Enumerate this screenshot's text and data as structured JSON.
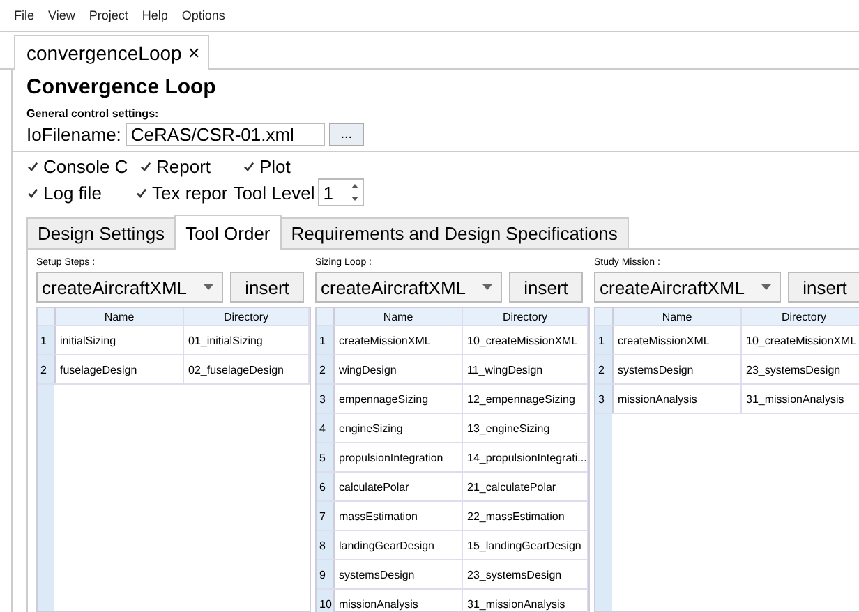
{
  "menu": [
    "File",
    "View",
    "Project",
    "Help",
    "Options"
  ],
  "document_tab": {
    "label": "convergenceLoop",
    "close": "✕",
    "selected": true
  },
  "title": "Convergence Loop",
  "section_label": "General control settings:",
  "io_file": {
    "label": "IoFilename:",
    "value": "CeRAS/CSR-01.xml",
    "button": "..."
  },
  "checkboxes": [
    {
      "label": "Console C",
      "checked": true
    },
    {
      "label": "Report",
      "checked": true
    },
    {
      "label": "Plot",
      "checked": true
    },
    {
      "label": "Log file",
      "checked": true
    },
    {
      "label": "Tex repor",
      "checked": true
    }
  ],
  "tool_level": {
    "label": "Tool Level",
    "value": "1"
  },
  "tabs": [
    {
      "label": "Design Settings",
      "selected": false
    },
    {
      "label": "Tool Order",
      "selected": true
    },
    {
      "label": "Requirements and Design Specifications",
      "selected": false
    }
  ],
  "lists": [
    {
      "label": "Setup Steps :",
      "combo": "createAircraftXML",
      "button": "insert",
      "columns": [
        "",
        "Name",
        "Directory"
      ],
      "rows": [
        [
          "1",
          "initialSizing",
          "01_initialSizing"
        ],
        [
          "2",
          "fuselageDesign",
          "02_fuselageDesign"
        ]
      ]
    },
    {
      "label": "Sizing Loop :",
      "combo": "createAircraftXML",
      "button": "insert",
      "columns": [
        "",
        "Name",
        "Directory"
      ],
      "rows": [
        [
          "1",
          "createMissionXML",
          "10_createMissionXML"
        ],
        [
          "2",
          "wingDesign",
          "11_wingDesign"
        ],
        [
          "3",
          "empennageSizing",
          "12_empennageSizing"
        ],
        [
          "4",
          "engineSizing",
          "13_engineSizing"
        ],
        [
          "5",
          "propulsionIntegration",
          "14_propulsionIntegrati..."
        ],
        [
          "6",
          "calculatePolar",
          "21_calculatePolar"
        ],
        [
          "7",
          "massEstimation",
          "22_massEstimation"
        ],
        [
          "8",
          "landingGearDesign",
          "15_landingGearDesign"
        ],
        [
          "9",
          "systemsDesign",
          "23_systemsDesign"
        ],
        [
          "10",
          "missionAnalysis",
          "31_missionAnalysis"
        ]
      ]
    },
    {
      "label": "Study Mission :",
      "combo": "createAircraftXML",
      "button": "insert",
      "columns": [
        "",
        "Name",
        "Directory"
      ],
      "rows": [
        [
          "1",
          "createMissionXML",
          "10_createMissionXML"
        ],
        [
          "2",
          "systemsDesign",
          "23_systemsDesign"
        ],
        [
          "3",
          "missionAnalysis",
          "31_missionAnalysis"
        ]
      ]
    }
  ]
}
